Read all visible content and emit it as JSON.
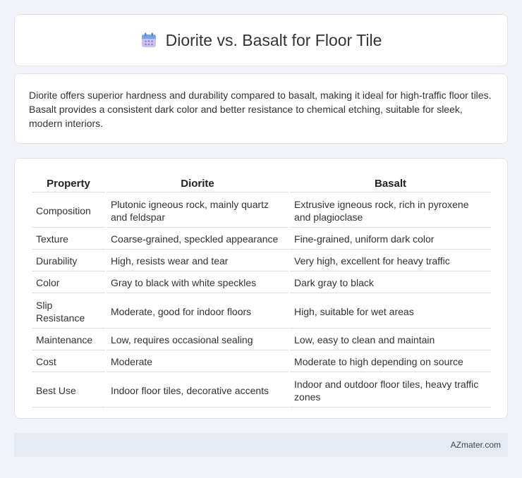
{
  "header": {
    "title": "Diorite vs. Basalt for Floor Tile",
    "icon": "calendar-icon"
  },
  "summary": {
    "text": "Diorite offers superior hardness and durability compared to basalt, making it ideal for high-traffic floor tiles. Basalt provides a consistent dark color and better resistance to chemical etching, suitable for sleek, modern interiors."
  },
  "table": {
    "headers": [
      "Property",
      "Diorite",
      "Basalt"
    ],
    "rows": [
      [
        "Composition",
        "Plutonic igneous rock, mainly quartz and feldspar",
        "Extrusive igneous rock, rich in pyroxene and plagioclase"
      ],
      [
        "Texture",
        "Coarse-grained, speckled appearance",
        "Fine-grained, uniform dark color"
      ],
      [
        "Durability",
        "High, resists wear and tear",
        "Very high, excellent for heavy traffic"
      ],
      [
        "Color",
        "Gray to black with white speckles",
        "Dark gray to black"
      ],
      [
        "Slip Resistance",
        "Moderate, good for indoor floors",
        "High, suitable for wet areas"
      ],
      [
        "Maintenance",
        "Low, requires occasional sealing",
        "Low, easy to clean and maintain"
      ],
      [
        "Cost",
        "Moderate",
        "Moderate to high depending on source"
      ],
      [
        "Best Use",
        "Indoor floor tiles, decorative accents",
        "Indoor and outdoor floor tiles, heavy traffic zones"
      ]
    ]
  },
  "footer": {
    "text": "AZmater.com"
  }
}
